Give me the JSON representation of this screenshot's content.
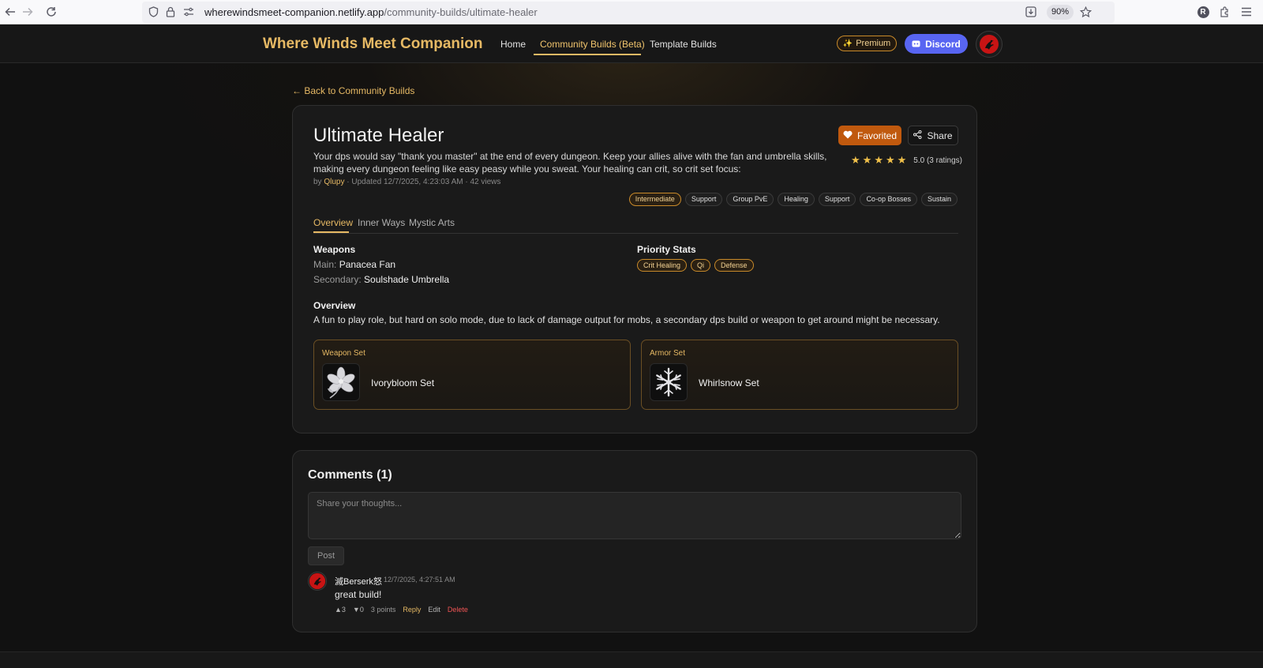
{
  "browser": {
    "url_host": "wherewindsmeet-companion.netlify.app",
    "url_path": "/community-builds/ultimate-healer",
    "zoom": "90%",
    "profile_initial": "R",
    "icons": [
      "back-icon",
      "forward-icon",
      "reload-icon",
      "shield-icon",
      "lock-icon",
      "permissions-icon",
      "download-icon",
      "star-bookmark-icon",
      "extensions-icon",
      "menu-icon"
    ]
  },
  "header": {
    "brand": "Where Winds Meet Companion",
    "nav": {
      "home": "Home",
      "community": "Community Builds (Beta)",
      "templates": "Template Builds"
    },
    "premium": "Premium",
    "discord": "Discord"
  },
  "back_link": "← Back to Community Builds",
  "build": {
    "title": "Ultimate Healer",
    "description": "Your dps would say \"thank you master\" at the end of every dungeon. Keep your allies alive with the fan and umbrella skills, making every dungeon feeling like easy peasy while you sweat. Your healing can crit, so crit set focus:",
    "meta_by": "by ",
    "author": "Qlupy",
    "meta_rest": " · Updated 12/7/2025, 4:23:03 AM · 42 views",
    "favorited": "Favorited",
    "share": "Share",
    "rating_value": 5.0,
    "rating_text": "5.0 (3 ratings)",
    "level_tag": "Intermediate",
    "tags": [
      "Support",
      "Group PvE",
      "Healing",
      "Support",
      "Co-op Bosses",
      "Sustain"
    ],
    "tabs": {
      "overview": "Overview",
      "inner_ways": "Inner Ways",
      "mystic_arts": "Mystic Arts"
    },
    "weapons_label": "Weapons",
    "main_label": "Main: ",
    "main_weapon": "Panacea Fan",
    "secondary_label": "Secondary: ",
    "secondary_weapon": "Soulshade Umbrella",
    "priority_label": "Priority Stats",
    "priority_stats": [
      "Crit Healing",
      "Qi",
      "Defense"
    ],
    "overview_label": "Overview",
    "overview_text": "A fun to play role, but hard on solo mode, due to lack of damage output for mobs, a secondary dps build or weapon to get around might be necessary.",
    "weapon_set_label": "Weapon Set",
    "weapon_set_name": "Ivorybloom Set",
    "armor_set_label": "Armor Set",
    "armor_set_name": "Whirlsnow Set"
  },
  "comments": {
    "title": "Comments (1)",
    "placeholder": "Share your thoughts...",
    "post": "Post",
    "items": [
      {
        "author": "滅Berserk怒",
        "time": "12/7/2025, 4:27:51 AM",
        "body": "great build!",
        "upvotes": "▲3",
        "downvotes": "▼0",
        "points": "3 points",
        "reply": "Reply",
        "edit": "Edit",
        "delete": "Delete"
      }
    ]
  },
  "colors": {
    "accent": "#e6b964",
    "favorite": "#c0590e",
    "discord": "#5865f2",
    "delete": "#ef5454"
  }
}
